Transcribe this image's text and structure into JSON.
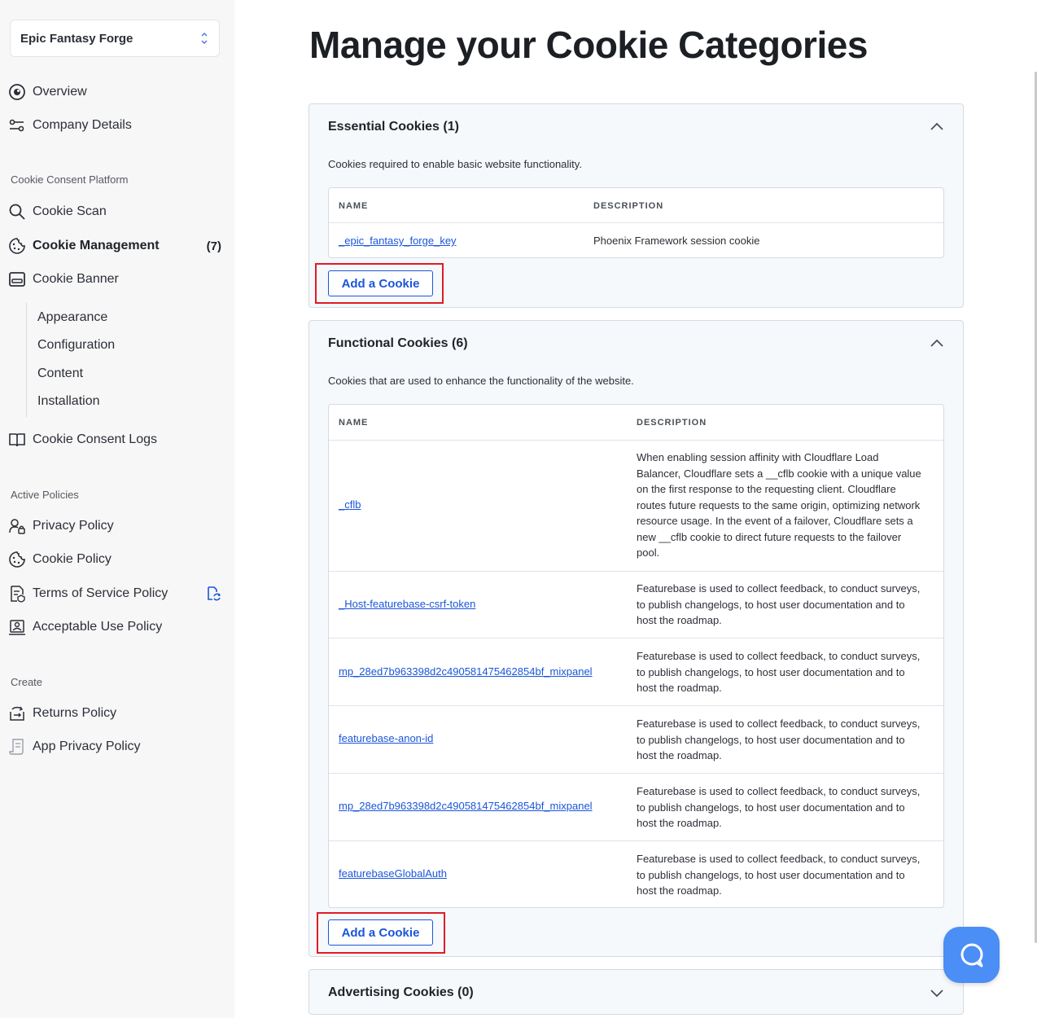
{
  "sidebar": {
    "workspace": "Epic Fantasy Forge",
    "overview": "Overview",
    "company_details": "Company Details",
    "section_ccp": "Cookie Consent Platform",
    "cookie_scan": "Cookie Scan",
    "cookie_management": "Cookie Management",
    "cookie_management_count": "(7)",
    "cookie_banner": "Cookie Banner",
    "banner_sub": [
      "Appearance",
      "Configuration",
      "Content",
      "Installation"
    ],
    "cookie_consent_logs": "Cookie Consent Logs",
    "section_active": "Active Policies",
    "privacy_policy": "Privacy Policy",
    "cookie_policy": "Cookie Policy",
    "terms_policy": "Terms of Service Policy",
    "acceptable_use": "Acceptable Use Policy",
    "section_create": "Create",
    "returns_policy": "Returns Policy",
    "app_privacy_policy": "App Privacy Policy"
  },
  "main": {
    "title": "Manage your Cookie Categories",
    "add_cookie_label": "Add a Cookie",
    "col_name": "NAME",
    "col_description": "DESCRIPTION",
    "essential": {
      "title": "Essential Cookies (1)",
      "desc": "Cookies required to enable basic website functionality.",
      "rows": [
        {
          "name": "_epic_fantasy_forge_key",
          "description": "Phoenix Framework session cookie"
        }
      ]
    },
    "functional": {
      "title": "Functional Cookies (6)",
      "desc": "Cookies that are used to enhance the functionality of the website.",
      "rows": [
        {
          "name": "_cflb",
          "description": "When enabling session affinity with Cloudflare Load Balancer, Cloudflare sets a __cflb cookie with a unique value on the first response to the requesting client. Cloudflare routes future requests to the same origin, optimizing network resource usage. In the event of a failover, Cloudflare sets a new __cflb cookie to direct future requests to the failover pool."
        },
        {
          "name": "_Host-featurebase-csrf-token",
          "description": "Featurebase is used to collect feedback, to conduct surveys, to publish changelogs, to host user documentation and to host the roadmap."
        },
        {
          "name": "mp_28ed7b963398d2c490581475462854bf_mixpanel",
          "description": "Featurebase is used to collect feedback, to conduct surveys, to publish changelogs, to host user documentation and to host the roadmap."
        },
        {
          "name": "featurebase-anon-id",
          "description": "Featurebase is used to collect feedback, to conduct surveys, to publish changelogs, to host user documentation and to host the roadmap."
        },
        {
          "name": "mp_28ed7b963398d2c490581475462854bf_mixpanel",
          "description": "Featurebase is used to collect feedback, to conduct surveys, to publish changelogs, to host user documentation and to host the roadmap."
        },
        {
          "name": "featurebaseGlobalAuth",
          "description": "Featurebase is used to collect feedback, to conduct surveys, to publish changelogs, to host user documentation and to host the roadmap."
        }
      ]
    },
    "advertising": {
      "title": "Advertising Cookies (0)"
    }
  },
  "colors": {
    "accent": "#1a56db",
    "highlight": "#e01b24",
    "chat": "#4b8ef5"
  },
  "icons": [
    "overview-icon",
    "company-details-icon",
    "search-icon",
    "cookie-icon",
    "banner-icon",
    "book-icon",
    "privacy-icon",
    "cookie-policy-icon",
    "terms-icon",
    "acceptable-use-icon",
    "returns-icon",
    "app-privacy-icon",
    "chevron-up-icon",
    "chevron-down-icon",
    "chat-icon"
  ]
}
